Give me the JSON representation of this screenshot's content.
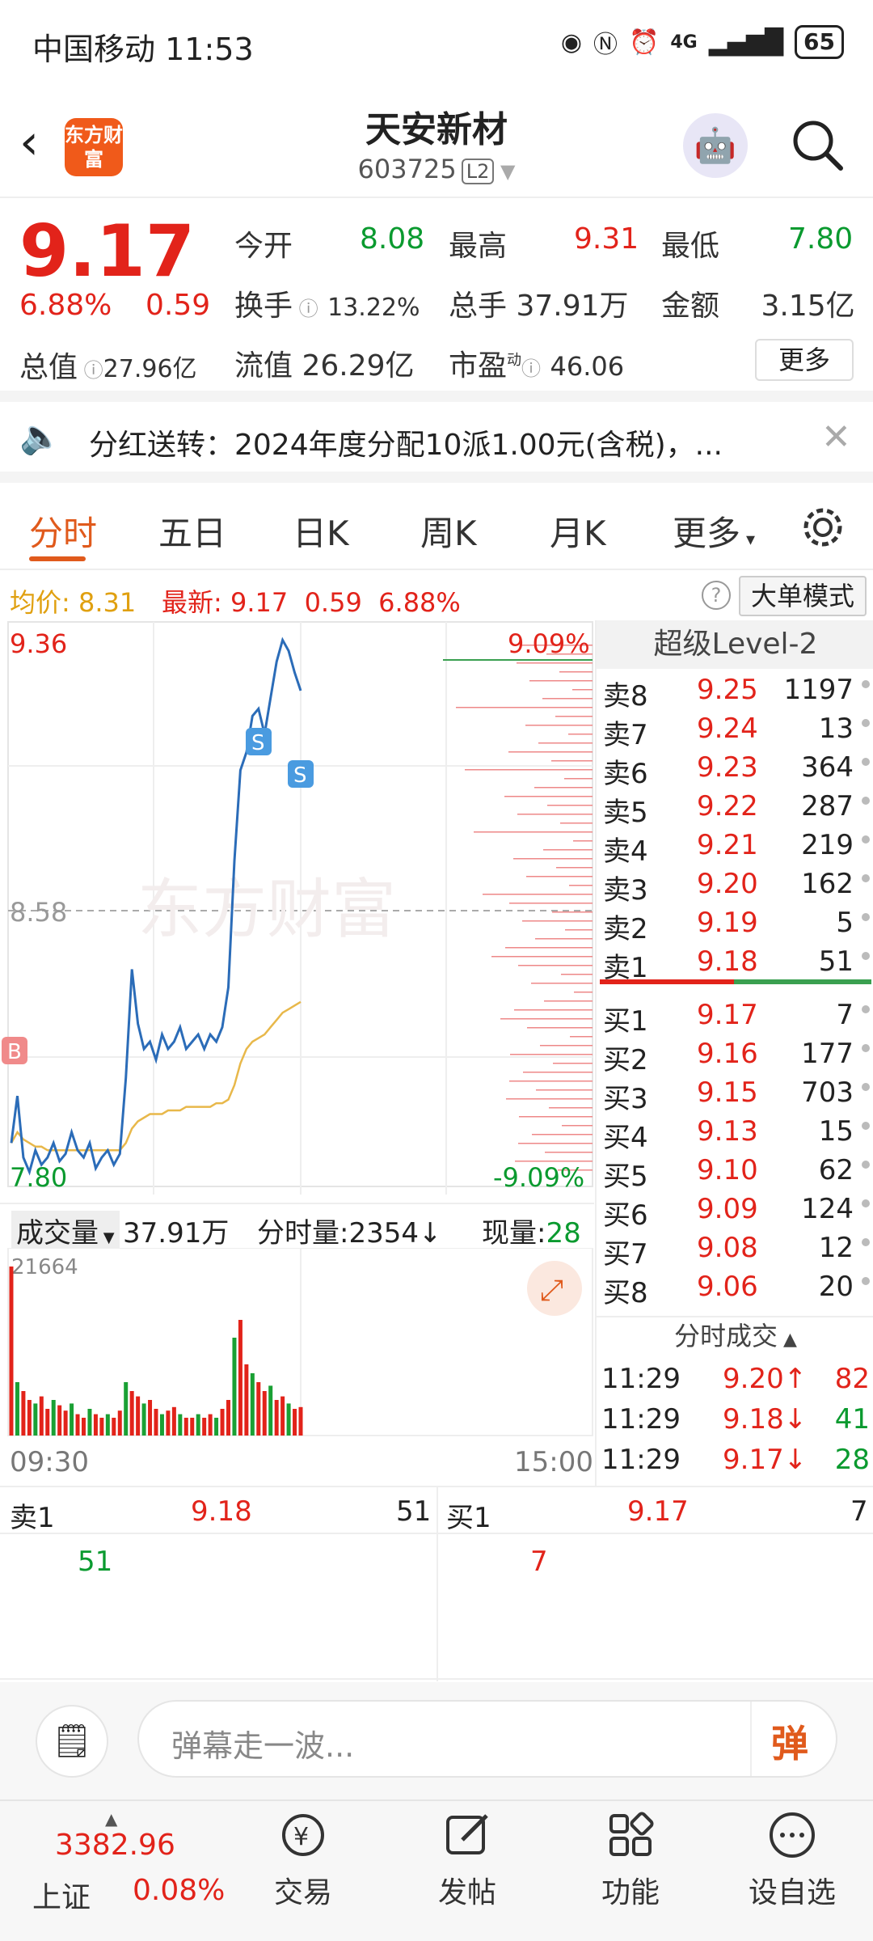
{
  "status_bar": {
    "carrier": "中国移动",
    "time": "11:53",
    "network": "4G",
    "battery": "65"
  },
  "nav": {
    "title": "天安新材",
    "code": "603725",
    "level_badge": "L2",
    "logo_text": "东方财富"
  },
  "quote": {
    "price": "9.17",
    "change_pct": "6.88%",
    "change": "0.59",
    "open_label": "今开",
    "open": "8.08",
    "high_label": "最高",
    "high": "9.31",
    "low_label": "最低",
    "low": "7.80",
    "turnover_label": "换手",
    "turnover": "13.22%",
    "volume_label": "总手",
    "volume": "37.91万",
    "amount_label": "金额",
    "amount": "3.15亿",
    "mktcap_label": "总值",
    "mktcap": "27.96亿",
    "float_label": "流值",
    "float": "26.29亿",
    "pe_label": "市盈",
    "pe_sup": "动",
    "pe": "46.06",
    "more_button": "更多"
  },
  "notice": {
    "text": "分红送转：2024年度分配10派1.00元(含税)，..."
  },
  "tabs": [
    "分时",
    "五日",
    "日K",
    "周K",
    "月K",
    "更多"
  ],
  "summary_row": {
    "avg_label": "均价:",
    "avg": "8.31",
    "latest_label": "最新:",
    "latest": "9.17",
    "change": "0.59",
    "change_pct": "6.88%",
    "mode_button": "大单模式"
  },
  "chart_data": {
    "type": "line",
    "y_max_label": "9.36",
    "y_mid_label": "8.58",
    "y_min_label": "7.80",
    "pct_max_label": "9.09%",
    "pct_min_label": "-9.09%",
    "x_start": "09:30",
    "x_end": "15:00",
    "watermark": "东方财富",
    "ylim": [
      7.8,
      9.36
    ],
    "series": [
      {
        "values": [
          7.92,
          8.05,
          7.88,
          7.84,
          7.9,
          7.86,
          7.88,
          7.92,
          7.87,
          7.89,
          7.95,
          7.9,
          7.88,
          7.92,
          7.85,
          7.88,
          7.9,
          7.86,
          7.89,
          8.1,
          8.4,
          8.25,
          8.18,
          8.2,
          8.15,
          8.22,
          8.18,
          8.2,
          8.24,
          8.18,
          8.2,
          8.22,
          8.18,
          8.22,
          8.2,
          8.24,
          8.35,
          8.7,
          8.95,
          9.0,
          9.1,
          9.12,
          9.05,
          9.15,
          9.25,
          9.31,
          9.28,
          9.22,
          9.17
        ]
      },
      {
        "values": [
          7.92,
          7.95,
          7.93,
          7.92,
          7.91,
          7.91,
          7.9,
          7.9,
          7.9,
          7.9,
          7.9,
          7.9,
          7.9,
          7.9,
          7.9,
          7.9,
          7.9,
          7.9,
          7.9,
          7.92,
          7.96,
          7.98,
          7.99,
          8.0,
          8.0,
          8.0,
          8.01,
          8.01,
          8.01,
          8.02,
          8.02,
          8.02,
          8.02,
          8.02,
          8.03,
          8.03,
          8.04,
          8.08,
          8.14,
          8.18,
          8.2,
          8.21,
          8.22,
          8.24,
          8.26,
          8.28,
          8.29,
          8.3,
          8.31
        ]
      }
    ]
  },
  "volume": {
    "label": "成交量",
    "total": "37.91万",
    "minute_label": "分时量:",
    "minute": "2354↓",
    "now_label": "现量:",
    "now": "28",
    "max_label": "21664",
    "bars": [
      0.95,
      0.3,
      0.25,
      0.2,
      0.18,
      0.22,
      0.15,
      0.2,
      0.17,
      0.14,
      0.18,
      0.12,
      0.1,
      0.15,
      0.12,
      0.1,
      0.12,
      0.1,
      0.14,
      0.3,
      0.25,
      0.22,
      0.18,
      0.2,
      0.15,
      0.12,
      0.14,
      0.16,
      0.12,
      0.1,
      0.1,
      0.12,
      0.1,
      0.12,
      0.1,
      0.15,
      0.2,
      0.55,
      0.65,
      0.4,
      0.35,
      0.3,
      0.25,
      0.28,
      0.2,
      0.22,
      0.18,
      0.15,
      0.16
    ]
  },
  "order_book": {
    "header": "超级Level-2",
    "asks": [
      {
        "label": "卖8",
        "price": "9.25",
        "vol": "1197"
      },
      {
        "label": "卖7",
        "price": "9.24",
        "vol": "13"
      },
      {
        "label": "卖6",
        "price": "9.23",
        "vol": "364"
      },
      {
        "label": "卖5",
        "price": "9.22",
        "vol": "287"
      },
      {
        "label": "卖4",
        "price": "9.21",
        "vol": "219"
      },
      {
        "label": "卖3",
        "price": "9.20",
        "vol": "162"
      },
      {
        "label": "卖2",
        "price": "9.19",
        "vol": "5"
      },
      {
        "label": "卖1",
        "price": "9.18",
        "vol": "51"
      }
    ],
    "bids": [
      {
        "label": "买1",
        "price": "9.17",
        "vol": "7"
      },
      {
        "label": "买2",
        "price": "9.16",
        "vol": "177"
      },
      {
        "label": "买3",
        "price": "9.15",
        "vol": "703"
      },
      {
        "label": "买4",
        "price": "9.13",
        "vol": "15"
      },
      {
        "label": "买5",
        "price": "9.10",
        "vol": "62"
      },
      {
        "label": "买6",
        "price": "9.09",
        "vol": "124"
      },
      {
        "label": "买7",
        "price": "9.08",
        "vol": "12"
      },
      {
        "label": "买8",
        "price": "9.06",
        "vol": "20"
      }
    ],
    "trades_header": "分时成交",
    "trades": [
      {
        "time": "11:29",
        "price": "9.20↑",
        "vol": "82"
      },
      {
        "time": "11:29",
        "price": "9.18↓",
        "vol": "41"
      },
      {
        "time": "11:29",
        "price": "9.17↓",
        "vol": "28"
      }
    ]
  },
  "level1": {
    "ask_label": "卖1",
    "ask_price": "9.18",
    "ask_vol": "51",
    "ask_sub": "51",
    "bid_label": "买1",
    "bid_price": "9.17",
    "bid_vol": "7",
    "bid_sub": "7"
  },
  "comment": {
    "placeholder": "弹幕走一波...",
    "danmu_button": "弹"
  },
  "bottom_nav": {
    "index_value": "3382.96",
    "index_name": "上证",
    "index_pct": "0.08%",
    "trade": "交易",
    "post": "发帖",
    "func": "功能",
    "watch": "设自选"
  },
  "markers": {
    "buy": "B",
    "sell": "S"
  }
}
